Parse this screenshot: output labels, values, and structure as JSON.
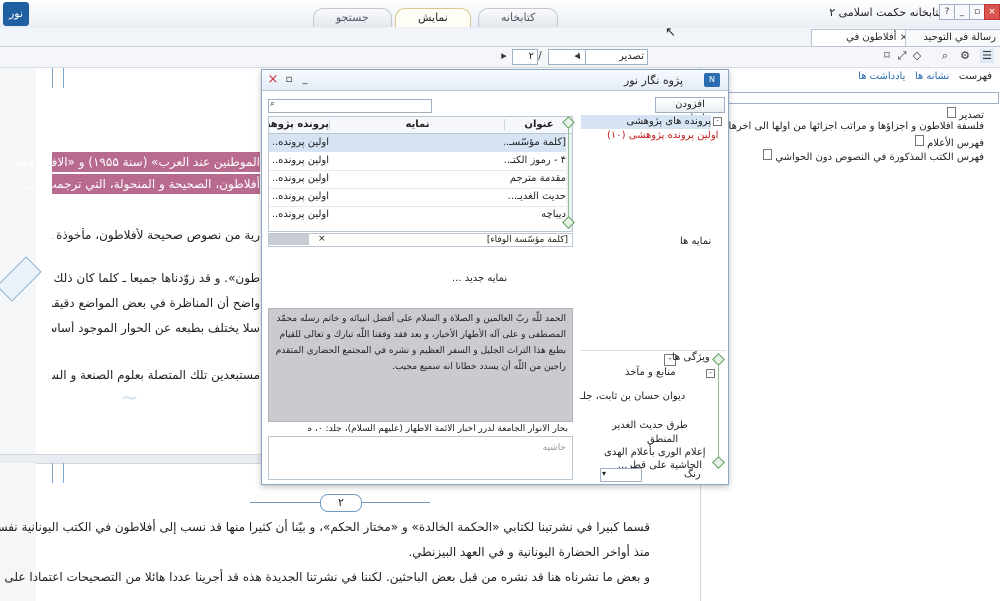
{
  "app": {
    "title": "کتابخانه حکمت اسلامی ۲",
    "logo_text": "نور"
  },
  "main_tabs": [
    {
      "label": "کتابخانه"
    },
    {
      "label": "نمایش"
    },
    {
      "label": "جستجو"
    }
  ],
  "doc_tabs": [
    {
      "label": "أفلاطون في الإسلام"
    },
    {
      "label": "رسالة في التوحيد"
    }
  ],
  "doc_tab_close": "×",
  "toolbar": {
    "view_mode": "تصدير",
    "page_input": "۱",
    "page_total": "۲"
  },
  "right_panel": {
    "header": {
      "fehrest": "فهرست",
      "nashaneh": "نشانه ها",
      "yaddasht": "يادداشت ها"
    },
    "items": [
      {
        "label": "تصدير"
      },
      {
        "label": "فلسفة أفلاطون و أجزاؤها و مراتب أجزائها من أولها الى آخرها لابى نصر الفارابى"
      },
      {
        "label": "فهرس الأعلام"
      },
      {
        "label": "فهرس الكتب المذكورة في النصوص دون الحواشي"
      }
    ]
  },
  "document": {
    "lines": [
      "الموطنين عند العرب» (سنة ۱۹۵۵) و «الافلاطونية",
      "أفلاطون، الصحيحة و المنحولة، التي ترجمت إلى",
      "رية من نصوص صحيحة لأفلاطون، مأخوذة ـ إما",
      "طون». و قد زوّدناها جميعا ـ كلما كان ذلك ممكنا",
      "واضح أن المناظرة في بعض المواضع دقيقة، و في",
      "سلا يختلف بطبعه عن الحوار الموجود أساسا في",
      "مستبعدين تلك المتصلة بعلوم الصنعة و السحر، و"
    ],
    "page_number": "٢",
    "lines_p2": [
      "قسما كبيرا في نشرتينا لكتابي «الحكمة الخالدة» و «مختار الحكم»، و بيّنا أن كثيرا منها قد نسب إلى أفلاطون في الكتب اليونانية نفسها،",
      "منذ أواخر الحضارة اليونانية و في العهد البيزنطي.",
      "و بعض ما نشرناه هنا قد نشره من قبل بعض الباحثين. لكننا في نشرتنا الجديدة هذه قد أجرينا عددا هائلا من التصحيحات اعتمادا على"
    ]
  },
  "dialog": {
    "title": "پژوه نگار نور",
    "add_note": "افزودن يادداشت",
    "search_placeholder": "",
    "columns": {
      "title": "عنوان",
      "index": "نمايه",
      "file": "پرونده پژوهشی"
    },
    "rows": [
      {
        "title": "[كلمة مؤسّسـ...",
        "index": "",
        "file": "اولين پرونده..."
      },
      {
        "title": "۴ - رموز الكتـ...",
        "index": "",
        "file": "اولين پرونده..."
      },
      {
        "title": "مقدمة مترجم",
        "index": "",
        "file": "اولين پرونده..."
      },
      {
        "title": "حديث الغديـ...",
        "index": "",
        "file": "اولين پرونده..."
      },
      {
        "title": "ديباچه",
        "index": "",
        "file": "اولين پرونده..."
      }
    ],
    "tree": {
      "root": "پرونده های پژوهشی",
      "child": "اولين پرونده پژوهشی (۱۰)"
    },
    "selected_item": "[كلمة مؤسّسة الوفاء]",
    "index_label": "نمايه ها",
    "new_index": "نمايه جديد ...",
    "quote": "الحمد للّه ربّ العالمين و الصلاة و السلام على أفضل انبيائه و خاتم رسله محمّد المصطفى و على آله الأطهار الأخيار، و بعد فقد وفقنا اللّه تبارك و تعالى للقيام بطبع هذا التراث الجليل و السفر العظيم و نشره في المجتمع الحضاري المتقدم راجين من اللّه أن يسدد خطانا انه سميع مجيب.",
    "source": "بحار الأنوار الجامعة لدرر أخبار الأئمة الأطهار (عليهم السلام)، جلد: ٠، صفحه: ٧",
    "footnote_placeholder": "حاشيه",
    "attributes": {
      "header": "ويژگی ها",
      "sources": "منابع و مآخذ",
      "items": [
        "ديوان حسان بن ثابت، جلـ",
        "طرق حديث الغدير",
        "المنطق",
        "إعلام الورى بأعلام الهدى",
        "الحاشية على قطر..."
      ],
      "color_label": "رنگ"
    }
  }
}
